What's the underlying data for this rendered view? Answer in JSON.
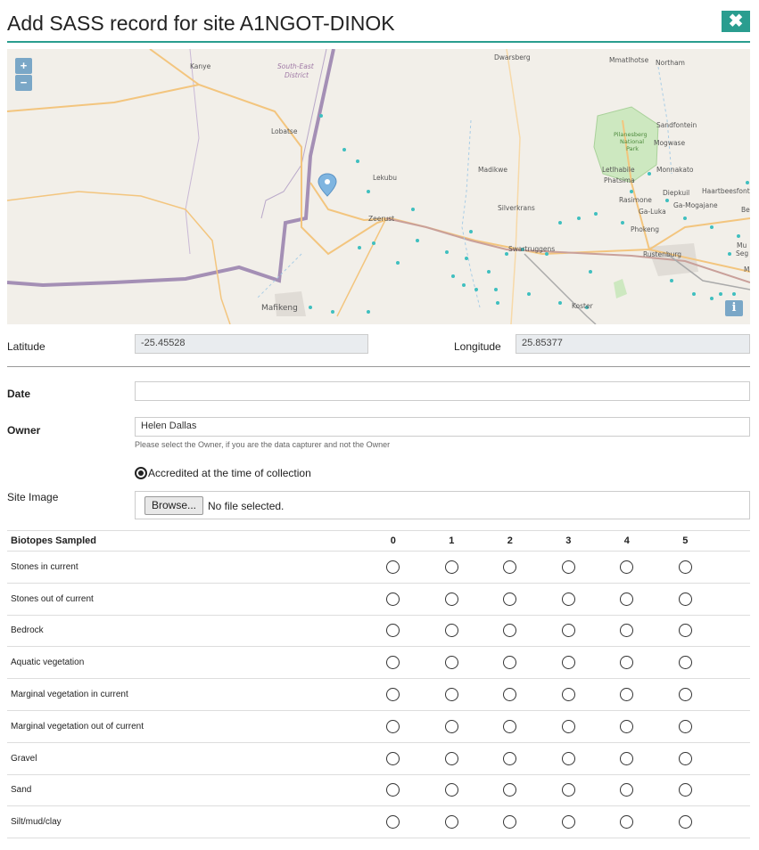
{
  "header": {
    "title": "Add SASS record for site A1NGOT-DINOK",
    "close_icon": "close-icon"
  },
  "map": {
    "zoom_in": "+",
    "zoom_out": "−",
    "info": "i",
    "places": [
      "Kanye",
      "South-East District",
      "Dwarsberg",
      "Mmatlhotse",
      "Northam",
      "Lobatse",
      "Lekubu",
      "Sandfontein",
      "Pilanesberg National Park",
      "Mogwase",
      "Madikwe",
      "Letlhabile",
      "Phatsima",
      "Monnakato",
      "Diepkuil",
      "Haartbeesfontein",
      "Zeerust",
      "Silverkrans",
      "Rasimone",
      "Ga-Luka",
      "Ga-Mogajane",
      "Bey",
      "Phokeng",
      "Swartruggens",
      "Rustenburg",
      "Mu",
      "Seg",
      "Mafikeng",
      "Koster",
      "Mo"
    ]
  },
  "coords": {
    "lat_label": "Latitude",
    "lat_value": "-25.45528",
    "lon_label": "Longitude",
    "lon_value": "25.85377"
  },
  "form": {
    "date_label": "Date",
    "date_value": "",
    "owner_label": "Owner",
    "owner_value": "Helen Dallas",
    "owner_help": "Please select the Owner, if you are the data capturer and not the Owner",
    "accredited_label": "Accredited at the time of collection",
    "site_image_label": "Site Image",
    "browse_label": "Browse...",
    "no_file": "No file selected."
  },
  "biotopes": {
    "header": "Biotopes Sampled",
    "columns": [
      "0",
      "1",
      "2",
      "3",
      "4",
      "5"
    ],
    "rows": [
      "Stones in current",
      "Stones out of current",
      "Bedrock",
      "Aquatic vegetation",
      "Marginal vegetation in current",
      "Marginal vegetation out of current",
      "Gravel",
      "Sand",
      "Silt/mud/clay"
    ]
  },
  "colors": {
    "accent": "#2a9d8f",
    "map_bg": "#f2efe9",
    "marker": "#7fb5e0",
    "dots": "#3fbfbf"
  }
}
